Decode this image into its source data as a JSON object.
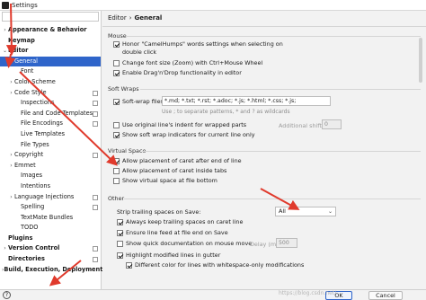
{
  "window": {
    "title": "Settings"
  },
  "sidebar": {
    "items": [
      {
        "label": "Appearance & Behavior",
        "bold": true,
        "chevron": "›",
        "selected": false,
        "project": false,
        "indent": 0
      },
      {
        "label": "Keymap",
        "bold": true,
        "chevron": "",
        "selected": false,
        "project": false,
        "indent": 0
      },
      {
        "label": "Editor",
        "bold": true,
        "chevron": "⌄",
        "selected": false,
        "project": false,
        "indent": 0
      },
      {
        "label": "General",
        "bold": false,
        "chevron": "›",
        "selected": true,
        "project": false,
        "indent": 1
      },
      {
        "label": "Font",
        "bold": false,
        "chevron": "",
        "selected": false,
        "project": false,
        "indent": 2
      },
      {
        "label": "Color Scheme",
        "bold": false,
        "chevron": "›",
        "selected": false,
        "project": false,
        "indent": 1
      },
      {
        "label": "Code Style",
        "bold": false,
        "chevron": "›",
        "selected": false,
        "project": true,
        "indent": 1
      },
      {
        "label": "Inspections",
        "bold": false,
        "chevron": "",
        "selected": false,
        "project": true,
        "indent": 2
      },
      {
        "label": "File and Code Templates",
        "bold": false,
        "chevron": "",
        "selected": false,
        "project": true,
        "indent": 2
      },
      {
        "label": "File Encodings",
        "bold": false,
        "chevron": "",
        "selected": false,
        "project": true,
        "indent": 2
      },
      {
        "label": "Live Templates",
        "bold": false,
        "chevron": "",
        "selected": false,
        "project": false,
        "indent": 2
      },
      {
        "label": "File Types",
        "bold": false,
        "chevron": "",
        "selected": false,
        "project": false,
        "indent": 2
      },
      {
        "label": "Copyright",
        "bold": false,
        "chevron": "›",
        "selected": false,
        "project": true,
        "indent": 1
      },
      {
        "label": "Emmet",
        "bold": false,
        "chevron": "›",
        "selected": false,
        "project": false,
        "indent": 1
      },
      {
        "label": "Images",
        "bold": false,
        "chevron": "",
        "selected": false,
        "project": false,
        "indent": 2
      },
      {
        "label": "Intentions",
        "bold": false,
        "chevron": "",
        "selected": false,
        "project": false,
        "indent": 2
      },
      {
        "label": "Language Injections",
        "bold": false,
        "chevron": "›",
        "selected": false,
        "project": true,
        "indent": 1
      },
      {
        "label": "Spelling",
        "bold": false,
        "chevron": "",
        "selected": false,
        "project": true,
        "indent": 2
      },
      {
        "label": "TextMate Bundles",
        "bold": false,
        "chevron": "",
        "selected": false,
        "project": false,
        "indent": 2
      },
      {
        "label": "TODO",
        "bold": false,
        "chevron": "",
        "selected": false,
        "project": false,
        "indent": 2
      },
      {
        "label": "Plugins",
        "bold": true,
        "chevron": "",
        "selected": false,
        "project": false,
        "indent": 0
      },
      {
        "label": "Version Control",
        "bold": true,
        "chevron": "›",
        "selected": false,
        "project": true,
        "indent": 0
      },
      {
        "label": "Directories",
        "bold": true,
        "chevron": "",
        "selected": false,
        "project": true,
        "indent": 0
      },
      {
        "label": "Build, Execution, Deployment",
        "bold": true,
        "chevron": "›",
        "selected": false,
        "project": false,
        "indent": 0
      }
    ]
  },
  "breadcrumb": {
    "parent": "Editor",
    "separator": "›",
    "current": "General"
  },
  "mouse": {
    "title": "Mouse",
    "camel_humps": {
      "label": "Honor \"CamelHumps\" words settings when selecting on",
      "label2": "double click",
      "checked": true
    },
    "zoom": {
      "label": "Change font size (Zoom) with Ctrl+Mouse Wheel",
      "checked": false
    },
    "drag_drop": {
      "label": "Enable Drag'n'Drop functionality in editor",
      "checked": true
    }
  },
  "soft_wraps": {
    "title": "Soft Wraps",
    "soft_wrap_files": {
      "label": "Soft-wrap files:",
      "checked": true,
      "value": "*.md; *.txt; *.rst; *.adoc; *.js; *.html; *.css; *.js;",
      "hint": "Use ; to separate patterns, * and ? as wildcards"
    },
    "original_indent": {
      "label": "Use original line's indent for wrapped parts",
      "checked": false
    },
    "additional_shift": {
      "label": "Additional shift:",
      "value": "0"
    },
    "show_indicators": {
      "label": "Show soft wrap indicators for current line only",
      "checked": true
    }
  },
  "virtual_space": {
    "title": "Virtual Space",
    "after_eol": {
      "label": "Allow placement of caret after end of line",
      "checked": true
    },
    "inside_tabs": {
      "label": "Allow placement of caret inside tabs",
      "checked": false
    },
    "at_bottom": {
      "label": "Show virtual space at file bottom",
      "checked": false
    }
  },
  "other": {
    "title": "Other",
    "strip_label": "Strip trailing spaces on Save:",
    "strip_value": "All",
    "keep_caret": {
      "label": "Always keep trailing spaces on caret line",
      "checked": true
    },
    "ensure_lf": {
      "label": "Ensure line feed at file end on Save",
      "checked": true
    },
    "quick_doc": {
      "label": "Show quick documentation on mouse move",
      "checked": false
    },
    "delay_label": "Delay (ms):",
    "delay_value": "500",
    "highlight_modified": {
      "label": "Highlight modified lines in gutter",
      "checked": true
    },
    "different_color": {
      "label": "Different color for lines with whitespace-only modifications",
      "checked": true
    }
  },
  "footer": {
    "help_glyph": "?",
    "ok": "OK",
    "cancel": "Cancel",
    "watermark": "https://blog.csdn.net/"
  },
  "colors": {
    "selection": "#2f65ca",
    "annotation_arrow": "#e03a2c"
  }
}
